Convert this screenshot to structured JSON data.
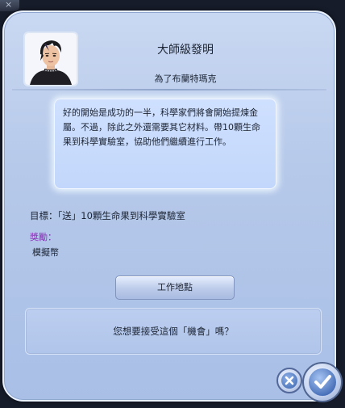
{
  "dialog": {
    "title": "大師級發明",
    "subtitle": "為了布蘭特瑪克",
    "description": "好的開始是成功的一半，科學家們將會開始提煉金屬。不過，除此之外還需要其它材料。帶10顆生命果到科學實驗室，協助他們繼續進行工作。",
    "goal": "目標：「送」10顆生命果到科學實驗室",
    "reward_label": "獎勵：",
    "reward_value": "模擬幣",
    "work_location_label": "工作地點",
    "prompt": "您想要接受這個「機會」嗎？"
  },
  "colors": {
    "dialog_bg": "#b6c9ea",
    "reward_label": "#8a2fb7",
    "accent_blue": "#3f68b3"
  },
  "icons": {
    "cancel": "close-icon",
    "accept": "checkmark-icon"
  }
}
